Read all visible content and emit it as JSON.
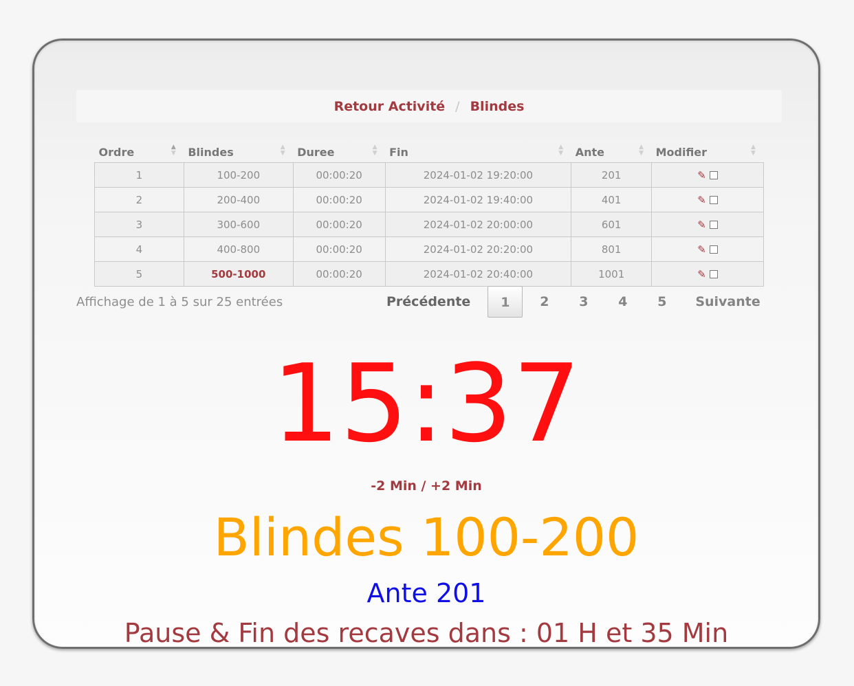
{
  "breadcrumb": {
    "back_label": "Retour Activité",
    "separator": "/",
    "current_label": "Blindes"
  },
  "table": {
    "headers": [
      "Ordre",
      "Blindes",
      "Duree",
      "Fin",
      "Ante",
      "Modifier"
    ],
    "rows": [
      {
        "ordre": "1",
        "blindes": "100-200",
        "duree": "00:00:20",
        "fin": "2024-01-02 19:20:00",
        "ante": "201"
      },
      {
        "ordre": "2",
        "blindes": "200-400",
        "duree": "00:00:20",
        "fin": "2024-01-02 19:40:00",
        "ante": "401"
      },
      {
        "ordre": "3",
        "blindes": "300-600",
        "duree": "00:00:20",
        "fin": "2024-01-02 20:00:00",
        "ante": "601"
      },
      {
        "ordre": "4",
        "blindes": "400-800",
        "duree": "00:00:20",
        "fin": "2024-01-02 20:20:00",
        "ante": "801"
      },
      {
        "ordre": "5",
        "blindes": "500-1000",
        "duree": "00:00:20",
        "fin": "2024-01-02 20:40:00",
        "ante": "1001"
      }
    ],
    "info": "Affichage de 1 à 5 sur 25 entrées"
  },
  "pagination": {
    "previous_label": "Précédente",
    "pages": [
      "1",
      "2",
      "3",
      "4",
      "5"
    ],
    "active_page": "1",
    "next_label": "Suivante"
  },
  "timer": {
    "time": "15:37",
    "adjust_label": "-2 Min / +2 Min"
  },
  "level": {
    "blinds_text": "Blindes 100-200",
    "ante_text": "Ante 201",
    "pause_text": "Pause & Fin des recaves dans : 01 H et 35 Min"
  },
  "colors": {
    "accent": "#a33a3f",
    "timer": "#ff0f0f",
    "blinds": "#ffa500",
    "ante": "#1010e6"
  },
  "icons": {
    "edit": "pencil-icon",
    "select": "checkbox-icon"
  }
}
